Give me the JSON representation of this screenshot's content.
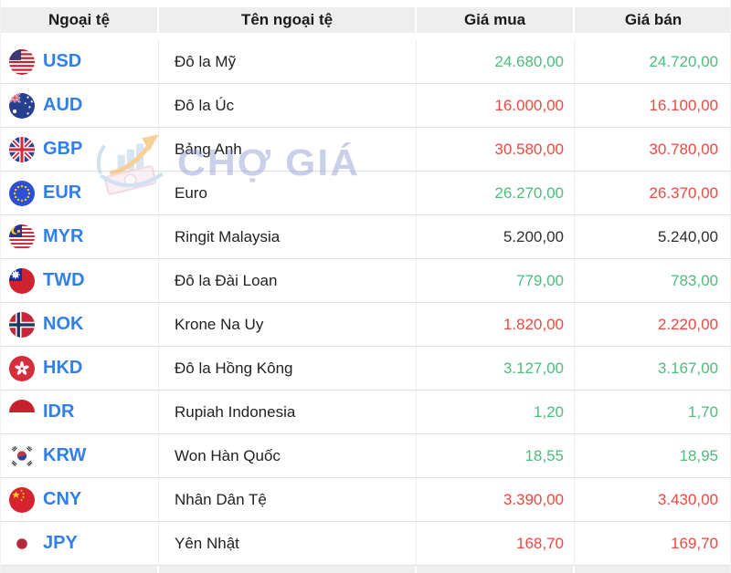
{
  "header": {
    "currency": "Ngoại tệ",
    "name": "Tên ngoại tệ",
    "buy": "Giá mua",
    "sell": "Giá bán"
  },
  "watermark": {
    "brand": "CHỢ GIÁ"
  },
  "colors": {
    "up": "#4dbd7c",
    "down": "#eb4a3c",
    "flat": "#2f2f2f",
    "code": "#2f80ed",
    "header_bg": "#eeeeee"
  },
  "rows": [
    {
      "code": "USD",
      "flag": "us",
      "name": "Đô la Mỹ",
      "buy": "24.680,00",
      "sell": "24.720,00",
      "buy_trend": "up",
      "sell_trend": "up"
    },
    {
      "code": "AUD",
      "flag": "au",
      "name": "Đô la Úc",
      "buy": "16.000,00",
      "sell": "16.100,00",
      "buy_trend": "down",
      "sell_trend": "down"
    },
    {
      "code": "GBP",
      "flag": "gb",
      "name": "Bảng Anh",
      "buy": "30.580,00",
      "sell": "30.780,00",
      "buy_trend": "down",
      "sell_trend": "down"
    },
    {
      "code": "EUR",
      "flag": "eu",
      "name": "Euro",
      "buy": "26.270,00",
      "sell": "26.370,00",
      "buy_trend": "up",
      "sell_trend": "down"
    },
    {
      "code": "MYR",
      "flag": "my",
      "name": "Ringit Malaysia",
      "buy": "5.200,00",
      "sell": "5.240,00",
      "buy_trend": "flat",
      "sell_trend": "flat"
    },
    {
      "code": "TWD",
      "flag": "tw",
      "name": "Đô la Đài Loan",
      "buy": "779,00",
      "sell": "783,00",
      "buy_trend": "up",
      "sell_trend": "up"
    },
    {
      "code": "NOK",
      "flag": "no",
      "name": "Krone Na Uy",
      "buy": "1.820,00",
      "sell": "2.220,00",
      "buy_trend": "down",
      "sell_trend": "down"
    },
    {
      "code": "HKD",
      "flag": "hk",
      "name": "Đô la Hồng Kông",
      "buy": "3.127,00",
      "sell": "3.167,00",
      "buy_trend": "up",
      "sell_trend": "up"
    },
    {
      "code": "IDR",
      "flag": "id",
      "name": "Rupiah Indonesia",
      "buy": "1,20",
      "sell": "1,70",
      "buy_trend": "up",
      "sell_trend": "up"
    },
    {
      "code": "KRW",
      "flag": "kr",
      "name": "Won Hàn Quốc",
      "buy": "18,55",
      "sell": "18,95",
      "buy_trend": "up",
      "sell_trend": "up"
    },
    {
      "code": "CNY",
      "flag": "cn",
      "name": "Nhân Dân Tệ",
      "buy": "3.390,00",
      "sell": "3.430,00",
      "buy_trend": "down",
      "sell_trend": "down"
    },
    {
      "code": "JPY",
      "flag": "jp",
      "name": "Yên Nhật",
      "buy": "168,70",
      "sell": "169,70",
      "buy_trend": "down",
      "sell_trend": "down"
    }
  ]
}
